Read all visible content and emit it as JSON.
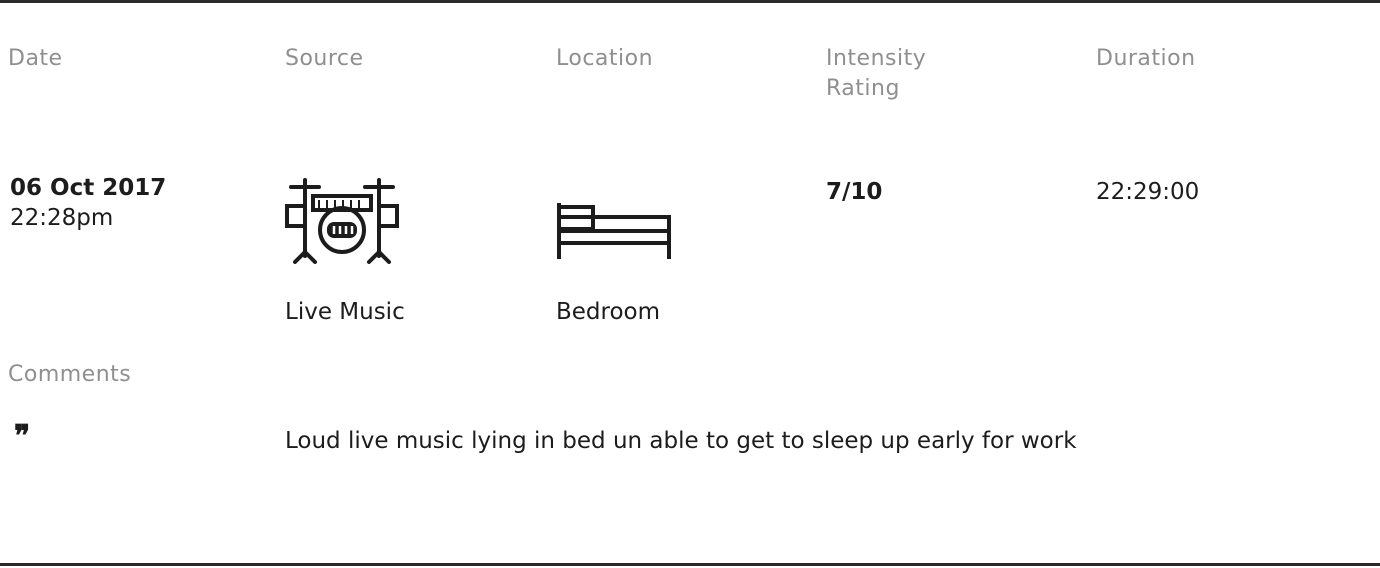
{
  "header": {
    "date": "Date",
    "source": "Source",
    "location": "Location",
    "intensity": "Intensity\nRating",
    "duration": "Duration"
  },
  "entry": {
    "date": "06 Oct 2017",
    "time": "22:28pm",
    "source": {
      "label": "Live Music",
      "icon": "drum-kit-icon"
    },
    "location": {
      "label": "Bedroom",
      "icon": "bed-icon"
    },
    "intensity": "7/10",
    "duration": "22:29:00"
  },
  "comments": {
    "label": "Comments",
    "icon": "quote-icon",
    "quote_glyph": "❞",
    "text": "Loud live music lying in bed un able to get to sleep up early for work"
  }
}
